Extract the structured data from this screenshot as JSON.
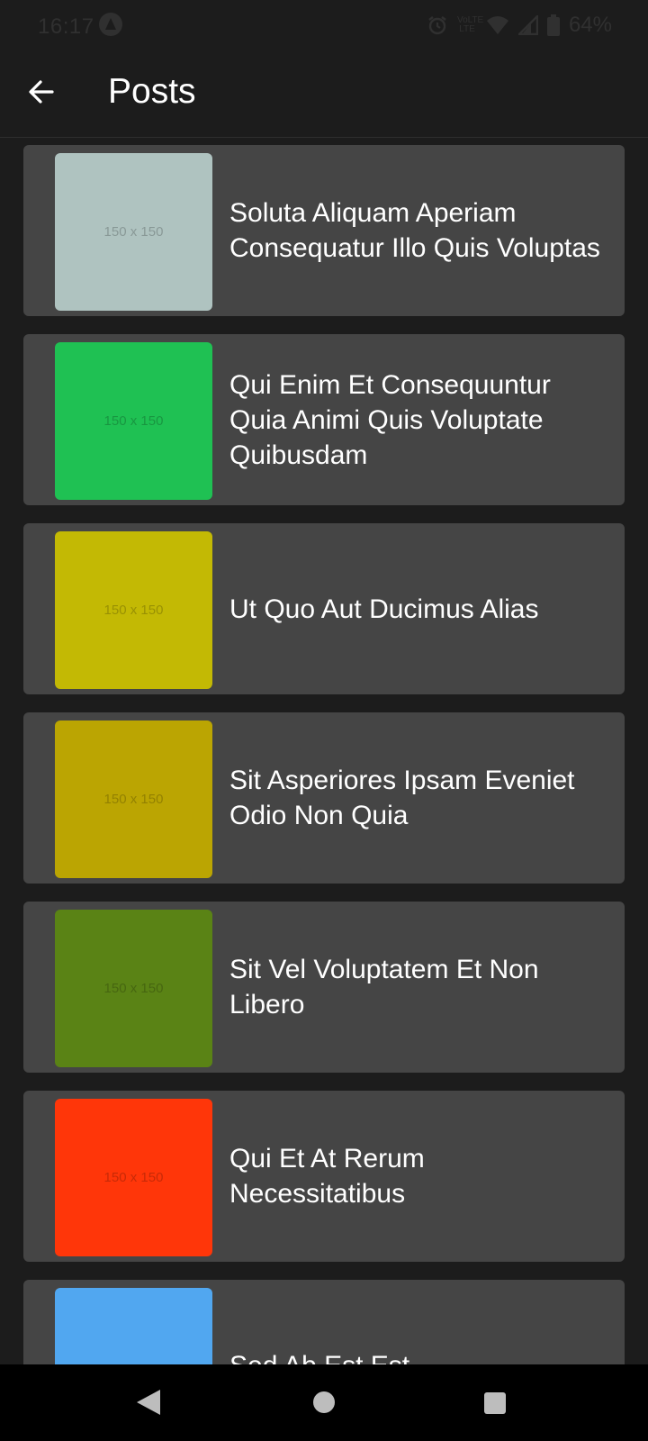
{
  "status_bar": {
    "time": "16:17",
    "volte_label_top": "VoLTE",
    "volte_label_bottom": "LTE",
    "battery_text": "64%",
    "icons": [
      "app-notification-icon",
      "alarm-icon",
      "volte-icon",
      "wifi-icon",
      "signal-icon",
      "battery-icon"
    ]
  },
  "app_bar": {
    "title": "Posts",
    "back_icon": "arrow-left-icon"
  },
  "posts": [
    {
      "title": "Soluta Aliquam Aperiam Consequatur Illo Quis Voluptas",
      "thumb_label": "150 x 150",
      "thumb_color": "#afc3c0"
    },
    {
      "title": "Qui Enim Et Consequuntur Quia Animi Quis Voluptate Quibusdam",
      "thumb_label": "150 x 150",
      "thumb_color": "#1fc153"
    },
    {
      "title": "Ut Quo Aut Ducimus Alias",
      "thumb_label": "150 x 150",
      "thumb_color": "#c3b904"
    },
    {
      "title": "Sit Asperiores Ipsam Eveniet Odio Non Quia",
      "thumb_label": "150 x 150",
      "thumb_color": "#bba502"
    },
    {
      "title": "Sit Vel Voluptatem Et Non Libero",
      "thumb_label": "150 x 150",
      "thumb_color": "#5a8315"
    },
    {
      "title": "Qui Et At Rerum Necessitatibus",
      "thumb_label": "150 x 150",
      "thumb_color": "#ff3609"
    },
    {
      "title": "Sed Ab Est Est",
      "thumb_label": "",
      "thumb_color": "#51a7f0"
    }
  ],
  "nav_bar": {
    "icons": [
      "nav-back-icon",
      "nav-home-icon",
      "nav-recents-icon"
    ]
  }
}
